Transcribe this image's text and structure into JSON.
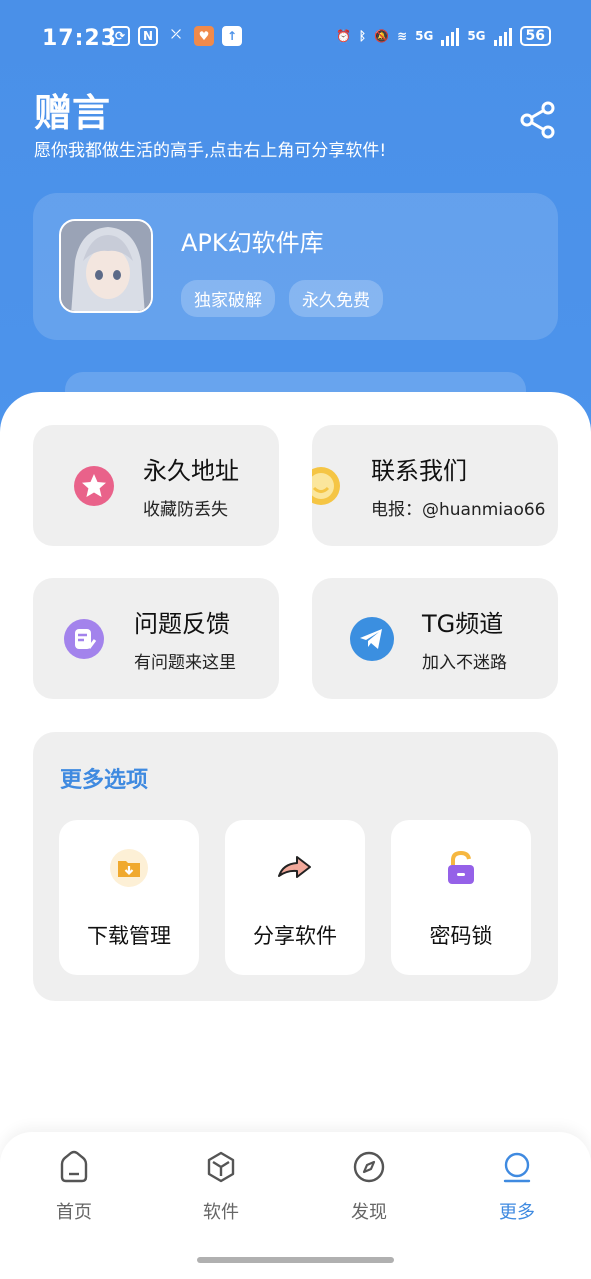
{
  "status_bar": {
    "time": "17:23",
    "network": "5G",
    "network2": "5G",
    "battery": "56"
  },
  "header": {
    "title": "赠言",
    "subtitle": "愿你我都做生活的高手,点击右上角可分享软件!",
    "share_icon": "share-icon"
  },
  "profile": {
    "app_name": "APK幻软件库",
    "tags": [
      "独家破解",
      "永久免费"
    ]
  },
  "tiles": [
    {
      "title": "永久地址",
      "subtitle": "收藏防丢失",
      "icon": "star-icon",
      "color": "#e8577f"
    },
    {
      "title": "联系我们",
      "subtitle": "电报：@huanmiao66",
      "icon": "smile-icon",
      "color": "#f3c13b"
    },
    {
      "title": "问题反馈",
      "subtitle": "有问题来这里",
      "icon": "feedback-icon",
      "color": "#9a79e8"
    },
    {
      "title": "TG频道",
      "subtitle": "加入不迷路",
      "icon": "telegram-icon",
      "color": "#3b8fe0"
    }
  ],
  "more": {
    "title": "更多选项",
    "options": [
      {
        "label": "下载管理",
        "icon": "download-folder-icon"
      },
      {
        "label": "分享软件",
        "icon": "share-arrow-icon"
      },
      {
        "label": "密码锁",
        "icon": "lock-icon"
      }
    ]
  },
  "tabbar": {
    "tabs": [
      {
        "label": "首页",
        "icon": "home-icon"
      },
      {
        "label": "软件",
        "icon": "box-icon"
      },
      {
        "label": "发现",
        "icon": "compass-icon"
      },
      {
        "label": "更多",
        "icon": "more-icon",
        "active": true
      }
    ]
  },
  "colors": {
    "primary": "#4a90e8",
    "accent_text": "#3f8ae0",
    "tile_bg": "#efefef"
  }
}
